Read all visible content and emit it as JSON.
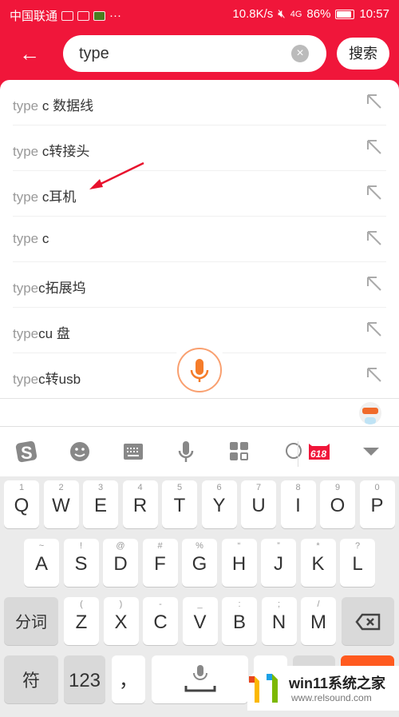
{
  "status": {
    "carrier": "中国联通",
    "speed": "10.8K/s",
    "network": "4G",
    "battery": "86%",
    "battery_level": 0.86,
    "time": "10:57"
  },
  "header": {
    "query": "type",
    "search_label": "搜索"
  },
  "suggestions": [
    {
      "prefix": "type",
      "rest": " c 数据线"
    },
    {
      "prefix": "type",
      "rest": " c转接头"
    },
    {
      "prefix": "type",
      "rest": " c耳机"
    },
    {
      "prefix": "type",
      "rest": " c"
    },
    {
      "prefix": "type",
      "rest": "c拓展坞"
    },
    {
      "prefix": "type",
      "rest": "cu 盘"
    },
    {
      "prefix": "type",
      "rest": "c转usb"
    }
  ],
  "ime_toolbar": [
    "sogou-logo-icon",
    "emoji-icon",
    "keyboard-icon",
    "voice-icon",
    "apps-grid-icon",
    "search-icon",
    "promo-618-icon",
    "collapse-icon"
  ],
  "promo_label": "618",
  "keyboard": {
    "row1": [
      [
        "Q",
        "1"
      ],
      [
        "W",
        "2"
      ],
      [
        "E",
        "3"
      ],
      [
        "R",
        "4"
      ],
      [
        "T",
        "5"
      ],
      [
        "Y",
        "6"
      ],
      [
        "U",
        "7"
      ],
      [
        "I",
        "8"
      ],
      [
        "O",
        "9"
      ],
      [
        "P",
        "0"
      ]
    ],
    "row2": [
      [
        "A",
        "~"
      ],
      [
        "S",
        "!"
      ],
      [
        "D",
        "@"
      ],
      [
        "F",
        "#"
      ],
      [
        "G",
        "%"
      ],
      [
        "H",
        "“"
      ],
      [
        "J",
        "”"
      ],
      [
        "K",
        "*"
      ],
      [
        "L",
        "?"
      ]
    ],
    "row3": [
      [
        "Z",
        "("
      ],
      [
        "X",
        ")"
      ],
      [
        "C",
        "-"
      ],
      [
        "V",
        "_"
      ],
      [
        "B",
        ":"
      ],
      [
        "N",
        ";"
      ],
      [
        "M",
        "/"
      ]
    ],
    "segment_label": "分词",
    "symbol_label": "符",
    "num_label": "123",
    "comma_label": "，"
  },
  "watermark": {
    "title": "win11系统之家",
    "url": "www.relsound.com"
  },
  "colors": {
    "brand": "#f0163a",
    "mic_accent": "#f57c2a",
    "action_key": "#ff5a1f"
  }
}
